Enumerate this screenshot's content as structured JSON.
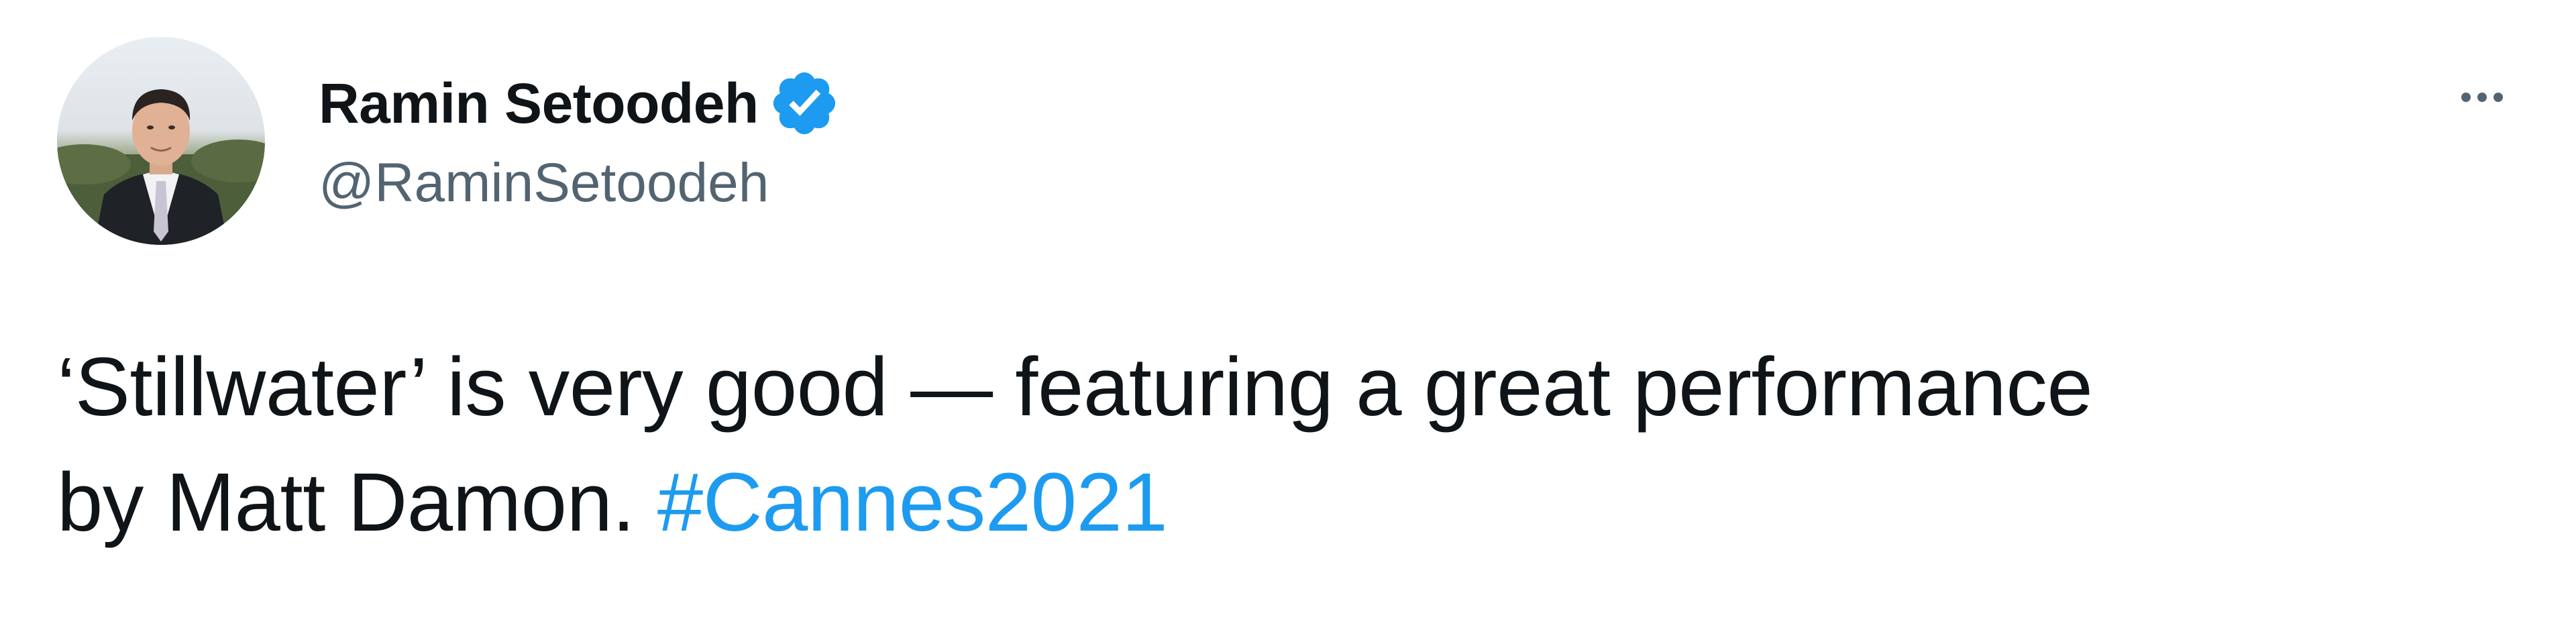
{
  "tweet": {
    "author": {
      "display_name": "Ramin Setoodeh",
      "handle": "@RaminSetoodeh",
      "verified": true
    },
    "text": {
      "line1": "‘Stillwater’ is very good — featuring a great performance",
      "line2_prefix": "by Matt Damon. ",
      "hashtag": "#Cannes2021"
    }
  },
  "icons": {
    "verified": "verified-badge-icon",
    "more": "more-options-icon"
  },
  "colors": {
    "text_primary": "#0f1419",
    "text_secondary": "#536471",
    "accent": "#1d9bf0",
    "background": "#ffffff"
  }
}
